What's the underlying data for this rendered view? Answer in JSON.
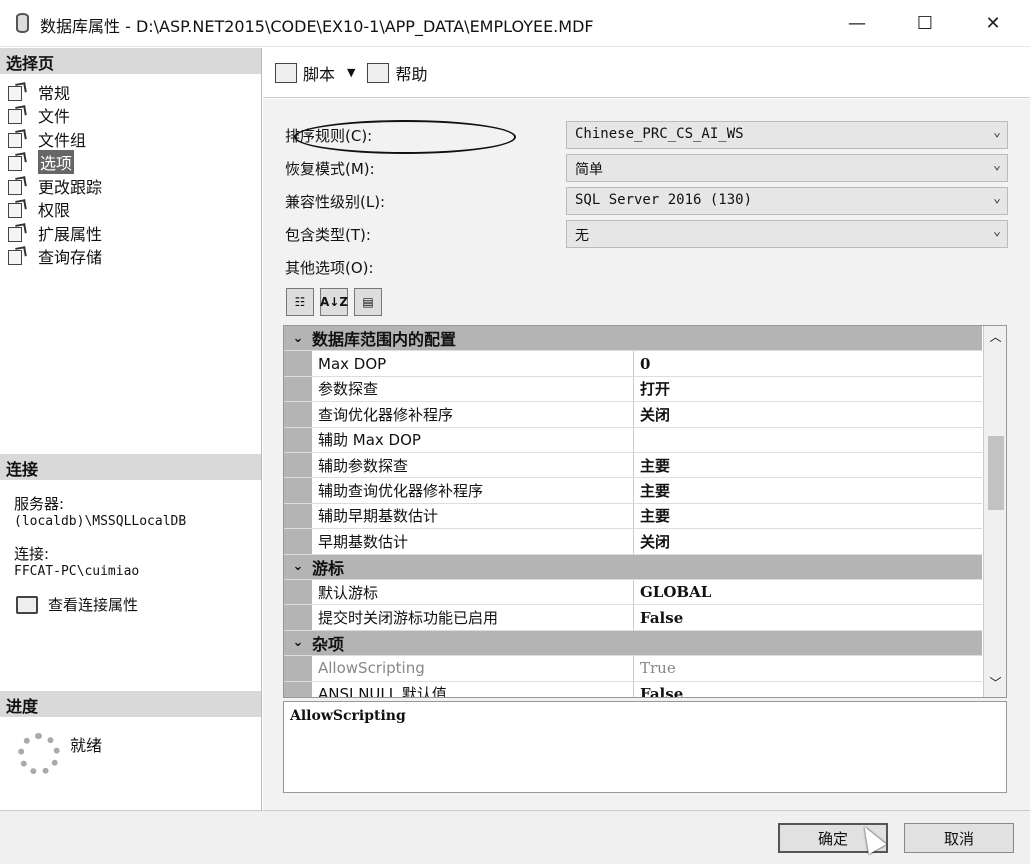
{
  "window": {
    "title": "数据库属性 - D:\\ASP.NET2015\\CODE\\EX10-1\\APP_DATA\\EMPLOYEE.MDF",
    "minimize": "—",
    "maximize": "☐",
    "close": "✕"
  },
  "left": {
    "select_page_header": "选择页",
    "pages": [
      {
        "label": "常规",
        "icon": "page-icon"
      },
      {
        "label": "文件",
        "icon": "page-icon"
      },
      {
        "label": "文件组",
        "icon": "page-icon"
      },
      {
        "label": "选项",
        "icon": "page-icon",
        "selected": true
      },
      {
        "label": "更改跟踪",
        "icon": "page-icon"
      },
      {
        "label": "权限",
        "icon": "page-icon"
      },
      {
        "label": "扩展属性",
        "icon": "page-icon"
      },
      {
        "label": "查询存储",
        "icon": "page-icon"
      }
    ],
    "connection_header": "连接",
    "server_label": "服务器:",
    "server_value": "(localdb)\\MSSQLLocalDB",
    "connection_label": "连接:",
    "connection_value": "FFCAT-PC\\cuimiao",
    "view_conn_props": "查看连接属性",
    "progress_header": "进度",
    "progress_status": "就绪"
  },
  "toolbar": {
    "script_label": "脚本",
    "dropdown_arrow": "▼",
    "help_label": "帮助"
  },
  "form": {
    "collation_label": "排序规则(C):",
    "collation_value": "Chinese_PRC_CS_AI_WS",
    "recovery_label": "恢复模式(M):",
    "recovery_value": "简单",
    "compat_label": "兼容性级别(L):",
    "compat_value": "SQL Server 2016 (130)",
    "containment_label": "包含类型(T):",
    "containment_value": "无",
    "other_options_label": "其他选项(O):",
    "chevron": "⌄"
  },
  "grid_tools": {
    "categorized": "☷",
    "alphabetical": "A↓Z",
    "property_pages": "▤"
  },
  "property_grid": {
    "categories": [
      {
        "name": "数据库范围内的配置",
        "props": [
          {
            "name": "Max DOP",
            "value": "0"
          },
          {
            "name": "参数探查",
            "value": "打开"
          },
          {
            "name": "查询优化器修补程序",
            "value": "关闭"
          },
          {
            "name": "辅助 Max DOP",
            "value": ""
          },
          {
            "name": "辅助参数探查",
            "value": "主要"
          },
          {
            "name": "辅助查询优化器修补程序",
            "value": "主要"
          },
          {
            "name": "辅助早期基数估计",
            "value": "主要"
          },
          {
            "name": "早期基数估计",
            "value": "关闭"
          }
        ]
      },
      {
        "name": "游标",
        "props": [
          {
            "name": "默认游标",
            "value": "GLOBAL"
          },
          {
            "name": "提交时关闭游标功能已启用",
            "value": "False"
          }
        ]
      },
      {
        "name": "杂项",
        "props": [
          {
            "name": "AllowScripting",
            "value": "True",
            "dim": true
          },
          {
            "name": "ANSI NULL 默认值",
            "value": "False"
          }
        ]
      }
    ],
    "scroll_up": "︿",
    "scroll_down": "﹀"
  },
  "description": {
    "text": "AllowScripting"
  },
  "footer": {
    "ok_label": "确定",
    "cancel_label": "取消"
  }
}
